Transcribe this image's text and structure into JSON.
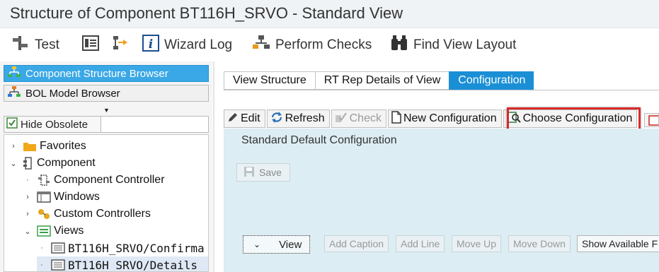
{
  "window": {
    "title": "Structure of Component BT116H_SRVO - Standard View"
  },
  "toolbar": {
    "test_label": "Test",
    "wizard_log_label": "Wizard Log",
    "perform_checks_label": "Perform Checks",
    "find_view_layout_label": "Find View Layout"
  },
  "sidebar": {
    "component_structure_browser": "Component Structure Browser",
    "bol_model_browser": "BOL Model Browser",
    "hide_obsolete": "Hide Obsolete",
    "tree": {
      "favorites": "Favorites",
      "component": "Component",
      "component_controller": "Component Controller",
      "windows": "Windows",
      "custom_controllers": "Custom Controllers",
      "views": "Views",
      "view_item_1": "BT116H_SRVO/Confirma",
      "view_item_2": "BT116H_SRVO/Details"
    }
  },
  "tabs": {
    "view_structure": "View Structure",
    "rt_rep_details": "RT Rep Details of View",
    "configuration": "Configuration"
  },
  "config_toolbar": {
    "edit": "Edit",
    "refresh": "Refresh",
    "check": "Check",
    "new_configuration": "New Configuration",
    "choose_configuration": "Choose Configuration"
  },
  "content": {
    "heading": "Standard Default Configuration",
    "save": "Save",
    "view_button": "View",
    "add_caption": "Add Caption",
    "add_line": "Add Line",
    "move_up": "Move Up",
    "move_down": "Move Down",
    "show_available": "Show Available F"
  },
  "colors": {
    "accent_blue": "#1a8fd6",
    "highlight_red": "#d9292b",
    "content_bg": "#dcedf3"
  }
}
